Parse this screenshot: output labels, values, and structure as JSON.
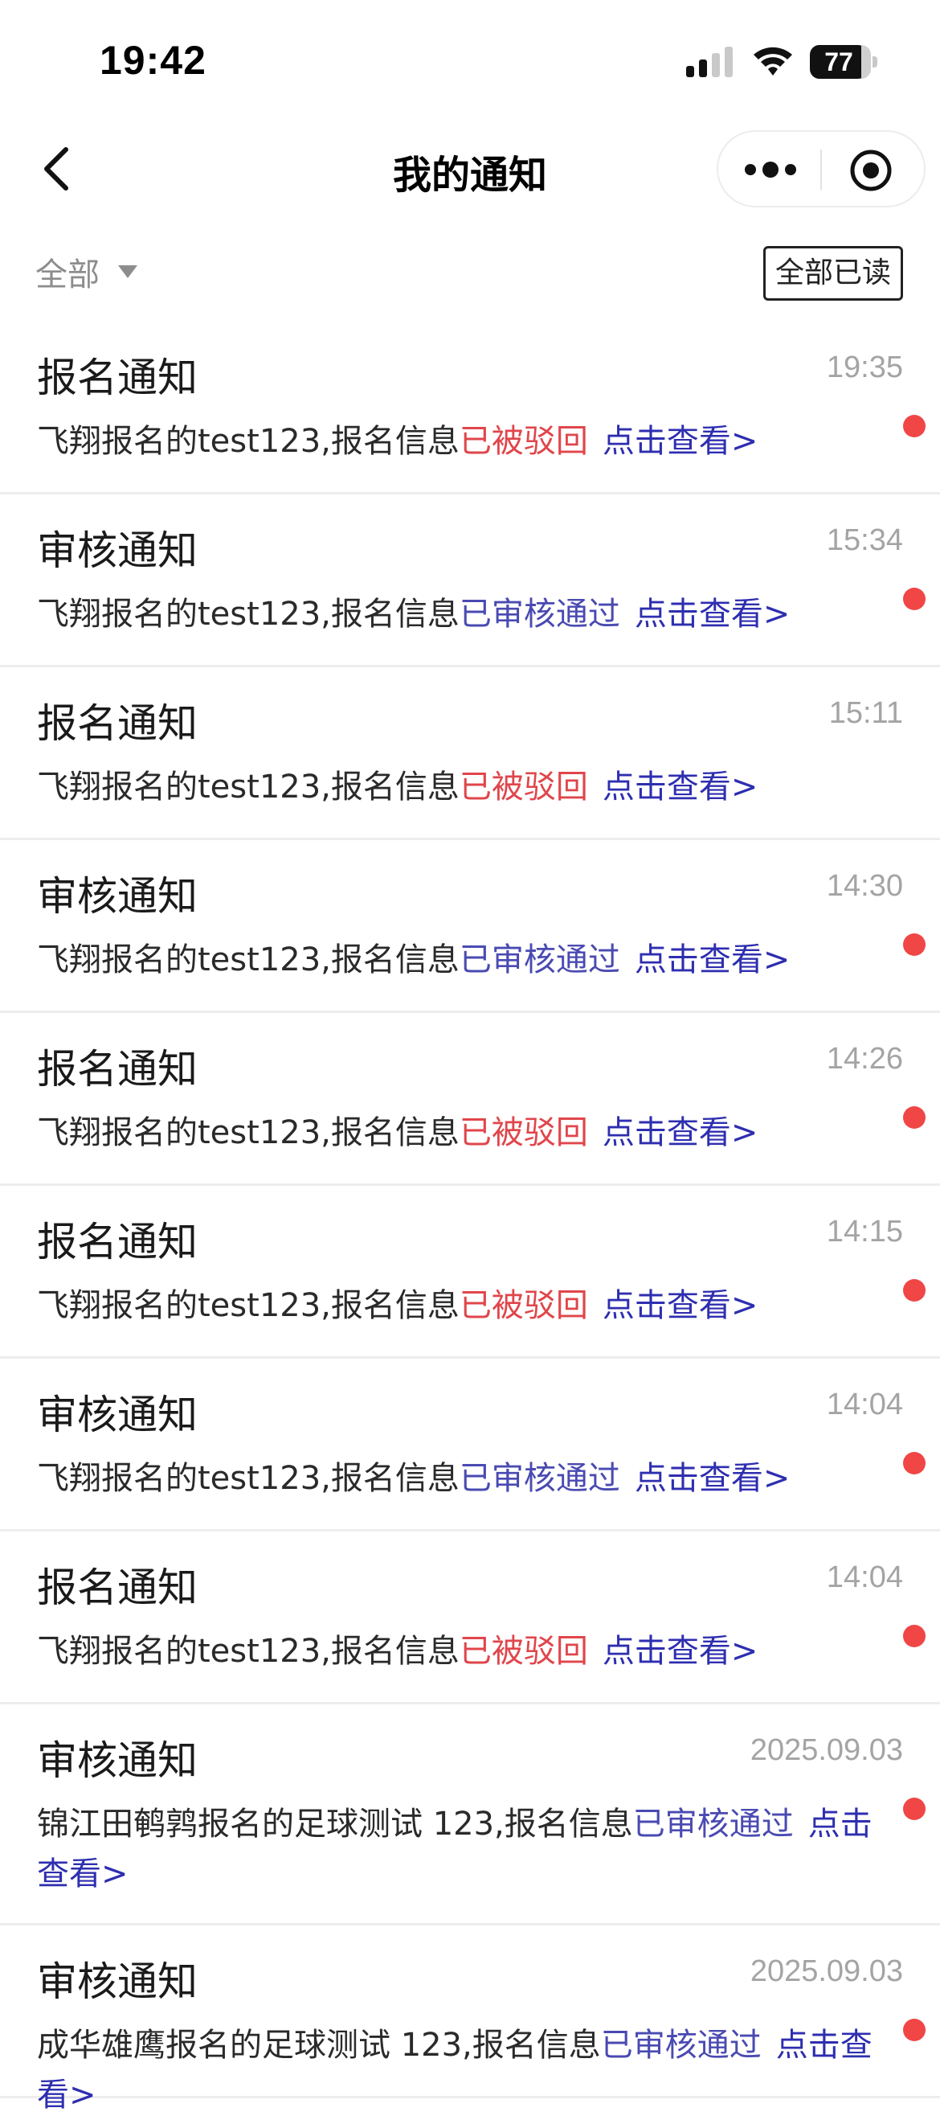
{
  "status_bar": {
    "time": "19:42",
    "battery": "77",
    "icons": [
      "signal-icon",
      "wifi-icon",
      "battery-icon"
    ]
  },
  "nav": {
    "title": "我的通知",
    "back_icon": "back-chevron-icon",
    "more_icon": "more-icon",
    "target_icon": "target-icon"
  },
  "filter": {
    "label": "全部",
    "mark_all_label": "全部已读"
  },
  "colors": {
    "rejected": "#e0464b",
    "approved": "#4a4ab2",
    "link": "#2e2eb0",
    "unread_dot": "#f04646"
  },
  "notifications": [
    {
      "title": "报名通知",
      "time": "19:35",
      "prefix": "飞翔报名的test123,报名信息",
      "status": "已被驳回",
      "status_type": "rejected",
      "link": "点击查看>",
      "unread": true
    },
    {
      "title": "审核通知",
      "time": "15:34",
      "prefix": "飞翔报名的test123,报名信息",
      "status": "已审核通过",
      "status_type": "approved",
      "link": "点击查看>",
      "unread": true
    },
    {
      "title": "报名通知",
      "time": "15:11",
      "prefix": "飞翔报名的test123,报名信息",
      "status": "已被驳回",
      "status_type": "rejected",
      "link": "点击查看>",
      "unread": false
    },
    {
      "title": "审核通知",
      "time": "14:30",
      "prefix": "飞翔报名的test123,报名信息",
      "status": "已审核通过",
      "status_type": "approved",
      "link": "点击查看>",
      "unread": true
    },
    {
      "title": "报名通知",
      "time": "14:26",
      "prefix": "飞翔报名的test123,报名信息",
      "status": "已被驳回",
      "status_type": "rejected",
      "link": "点击查看>",
      "unread": true
    },
    {
      "title": "报名通知",
      "time": "14:15",
      "prefix": "飞翔报名的test123,报名信息",
      "status": "已被驳回",
      "status_type": "rejected",
      "link": "点击查看>",
      "unread": true
    },
    {
      "title": "审核通知",
      "time": "14:04",
      "prefix": "飞翔报名的test123,报名信息",
      "status": "已审核通过",
      "status_type": "approved",
      "link": "点击查看>",
      "unread": true
    },
    {
      "title": "报名通知",
      "time": "14:04",
      "prefix": "飞翔报名的test123,报名信息",
      "status": "已被驳回",
      "status_type": "rejected",
      "link": "点击查看>",
      "unread": true
    },
    {
      "title": "审核通知",
      "time": "2025.09.03",
      "prefix": "锦江田鹌鹑报名的足球测试 123,报名信息",
      "status": "已审核通过",
      "status_type": "approved",
      "link": "点击查看>",
      "unread": true
    },
    {
      "title": "审核通知",
      "time": "2025.09.03",
      "prefix": "成华雄鹰报名的足球测试 123,报名信息",
      "status": "已审核通过",
      "status_type": "approved",
      "link": "点击查看>",
      "unread": true
    }
  ]
}
